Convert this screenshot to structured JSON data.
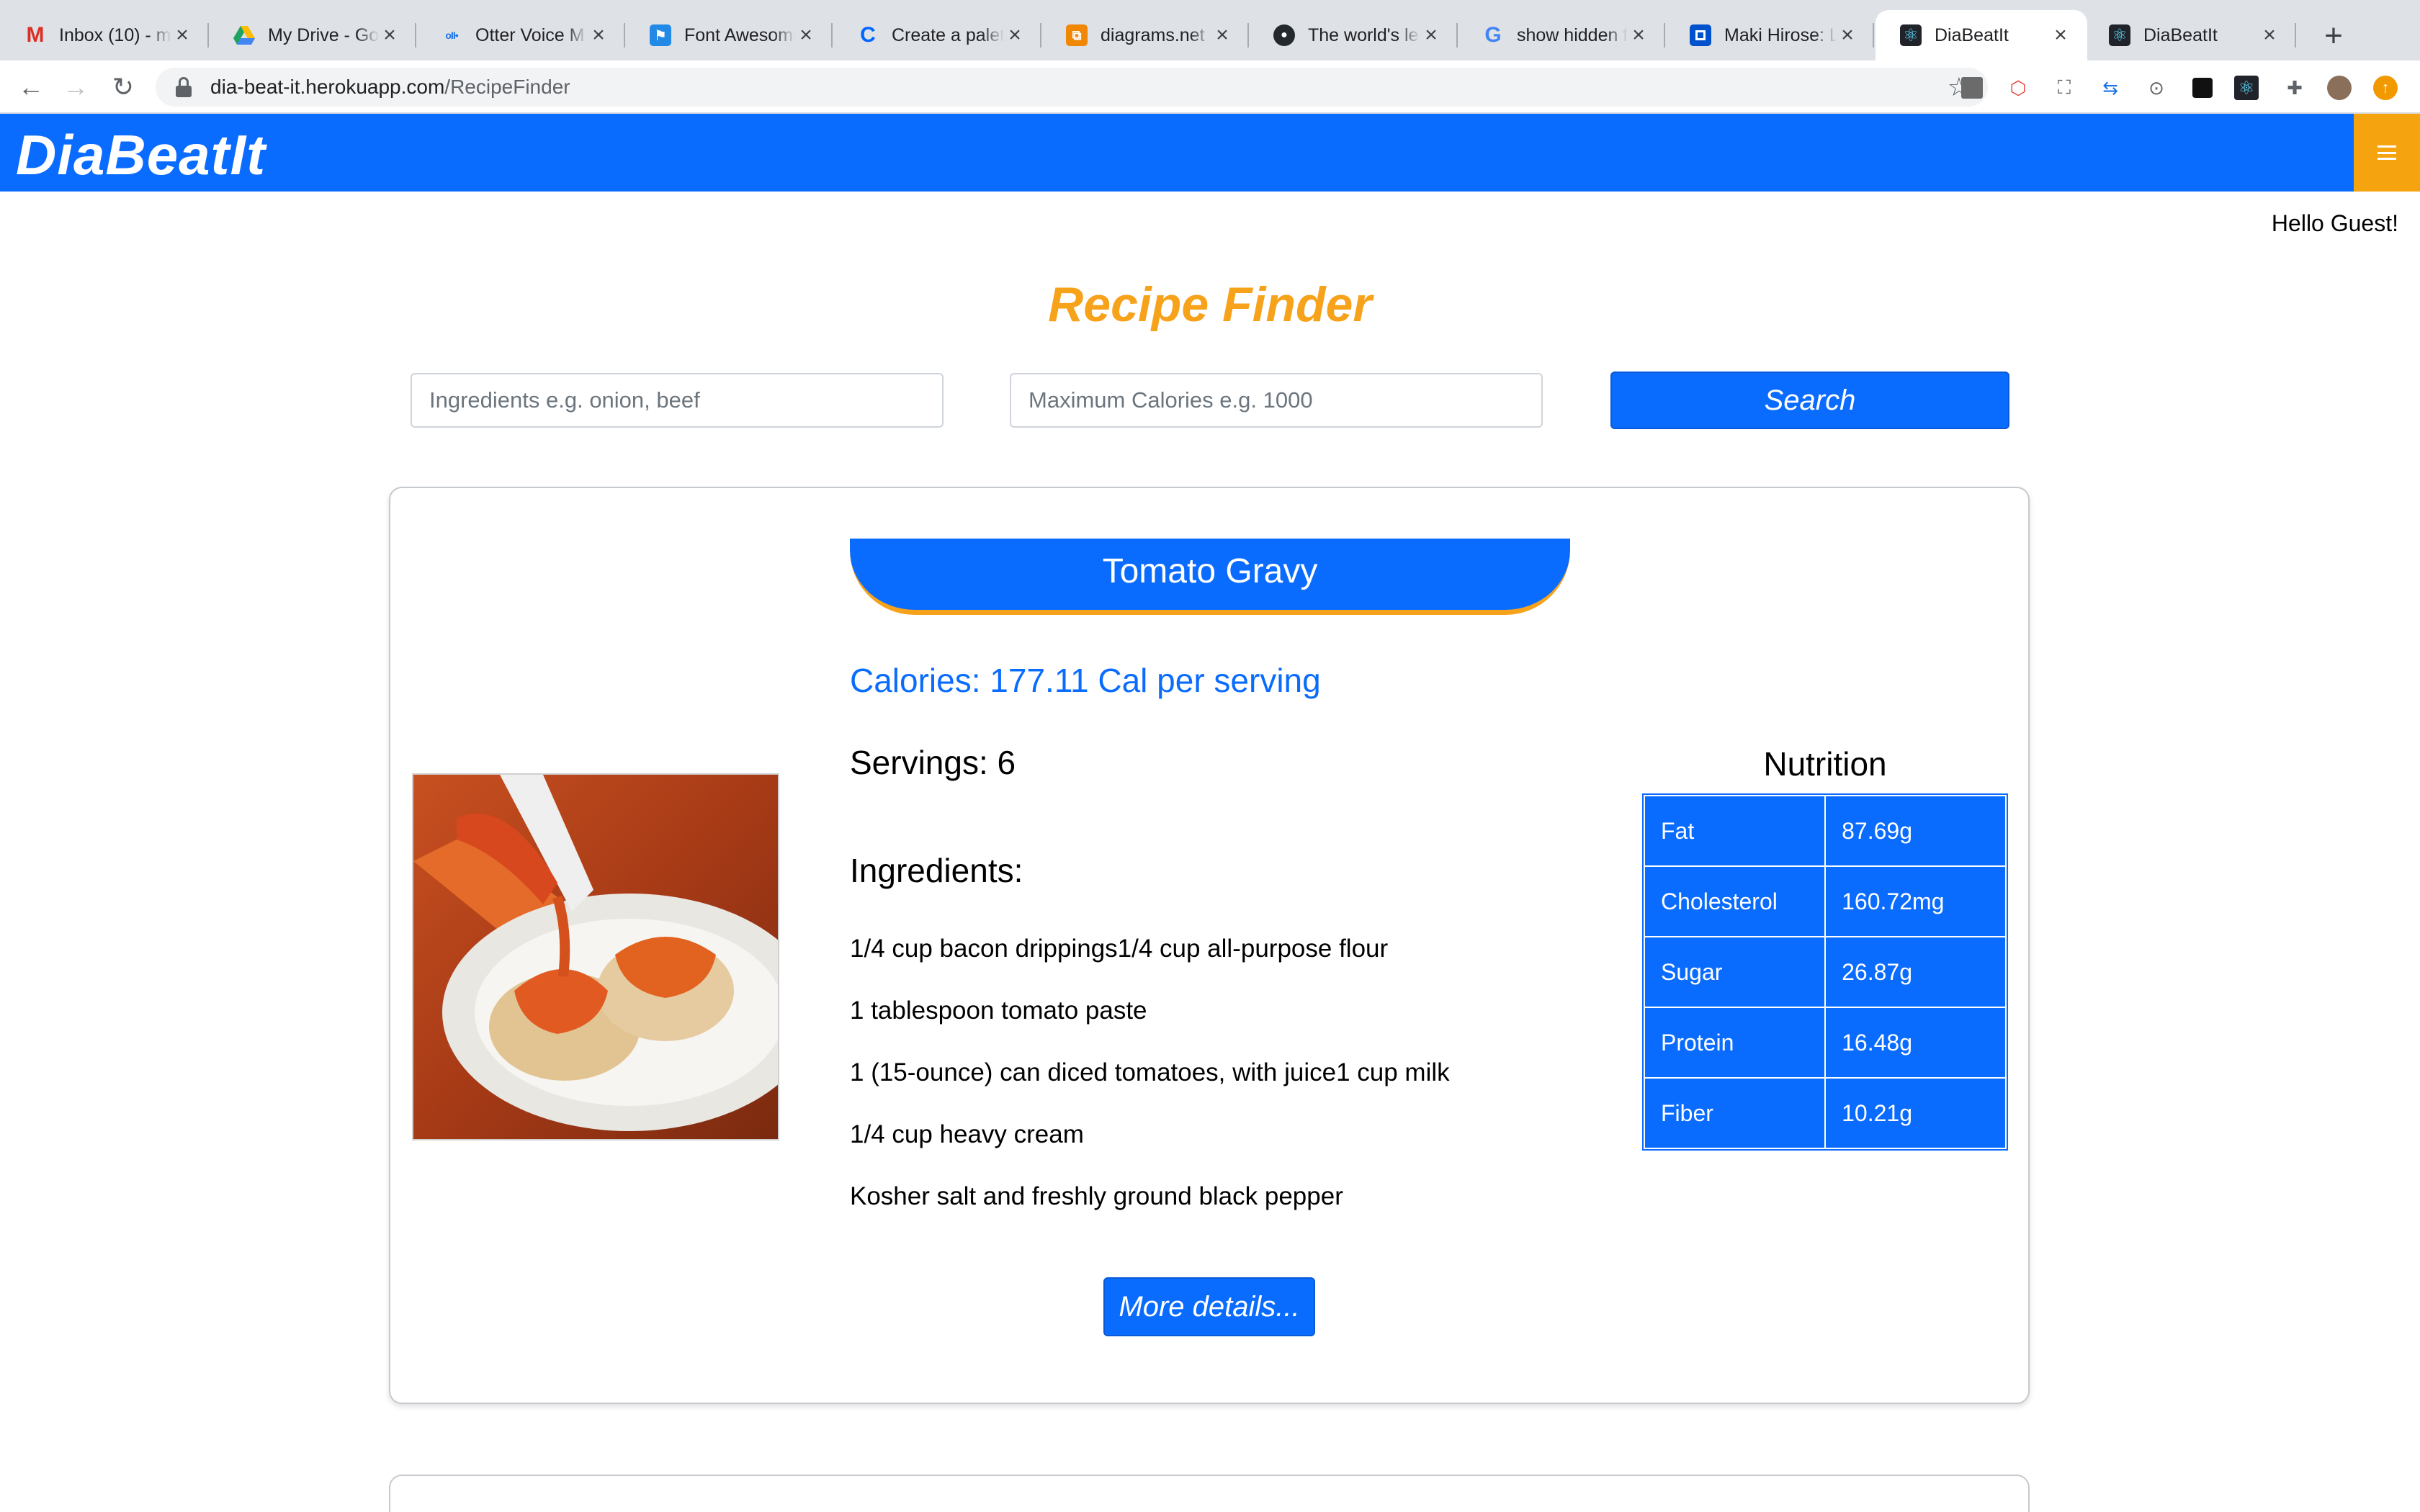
{
  "browser": {
    "tabs": [
      {
        "title": "Inbox (10) - m",
        "icon": "gmail-icon"
      },
      {
        "title": "My Drive - Go",
        "icon": "google-drive-icon"
      },
      {
        "title": "Otter Voice M",
        "icon": "otter-icon"
      },
      {
        "title": "Font Awesome",
        "icon": "font-awesome-icon"
      },
      {
        "title": "Create a palet",
        "icon": "coolors-icon"
      },
      {
        "title": "diagrams.net",
        "icon": "diagrams-icon"
      },
      {
        "title": "The world's le",
        "icon": "github-icon"
      },
      {
        "title": "show hidden f",
        "icon": "google-icon"
      },
      {
        "title": "Maki Hirose: L",
        "icon": "trello-icon"
      },
      {
        "title": "DiaBeatIt",
        "icon": "react-icon",
        "active": true
      },
      {
        "title": "DiaBeatIt",
        "icon": "react-icon"
      }
    ],
    "url_host": "dia-beat-it.herokuapp.com",
    "url_path": "/RecipeFinder"
  },
  "app": {
    "brand": "DiaBeatIt",
    "greeting": "Hello Guest!",
    "accent": "#0a6cff",
    "highlight": "#f7a21b"
  },
  "finder": {
    "title": "Recipe Finder",
    "ingredients_placeholder": "Ingredients e.g. onion, beef",
    "calories_placeholder": "Maximum Calories e.g. 1000",
    "search_label": "Search"
  },
  "recipe": {
    "title": "Tomato Gravy",
    "calories": "Calories: 177.11 Cal per serving",
    "servings": "Servings: 6",
    "ingredients_heading": "Ingredients:",
    "ingredients": [
      "1/4 cup bacon drippings1/4 cup all-purpose flour",
      "1 tablespoon tomato paste",
      "1 (15-ounce) can diced tomatoes, with juice1 cup milk",
      "1/4 cup heavy cream",
      "Kosher salt and freshly ground black pepper"
    ],
    "nutrition_title": "Nutrition",
    "nutrition": [
      {
        "label": "Fat",
        "value": "87.69g"
      },
      {
        "label": "Cholesterol",
        "value": "160.72mg"
      },
      {
        "label": "Sugar",
        "value": "26.87g"
      },
      {
        "label": "Protein",
        "value": "16.48g"
      },
      {
        "label": "Fiber",
        "value": "10.21g"
      }
    ],
    "more_label": "More details..."
  }
}
